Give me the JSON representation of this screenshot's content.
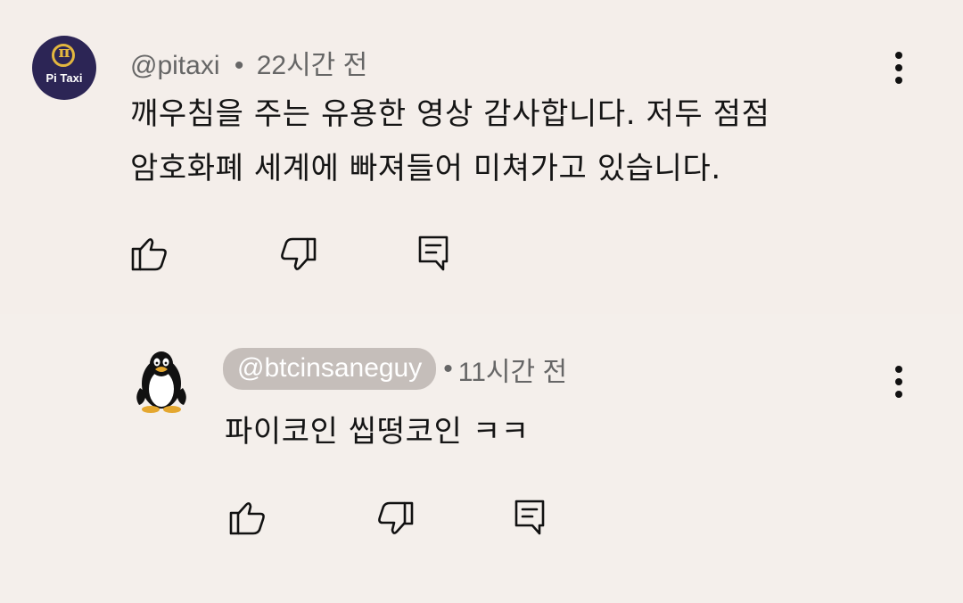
{
  "comments": [
    {
      "handle": "@pitaxi",
      "separator": "•",
      "time": "22시간 전",
      "text": "깨우침을 주는 유용한 영상 감사합니다. 저두 점점\n암호화폐 세계에 빠져들어 미쳐가고 있습니다.",
      "avatar": {
        "text": "Pi Taxi",
        "colors": {
          "background": "#2c2555",
          "accent": "#e3b73f"
        }
      },
      "icons": {
        "like": "thumb-up-icon",
        "dislike": "thumb-down-icon",
        "reply": "reply-icon",
        "menu": "more-vert-icon"
      }
    },
    {
      "handle": "@btcinsaneguy",
      "separator": "•",
      "time": "11시간 전",
      "text": "파이코인 씹떵코인 ㅋㅋ",
      "avatar": {
        "kind": "penguin"
      },
      "icons": {
        "like": "thumb-up-icon",
        "dislike": "thumb-down-icon",
        "reply": "reply-icon",
        "menu": "more-vert-icon"
      }
    }
  ],
  "colors": {
    "background": "#f4eeea",
    "meta_text": "#666666",
    "body_text": "#151515",
    "handle_pill": "#c5beba"
  }
}
